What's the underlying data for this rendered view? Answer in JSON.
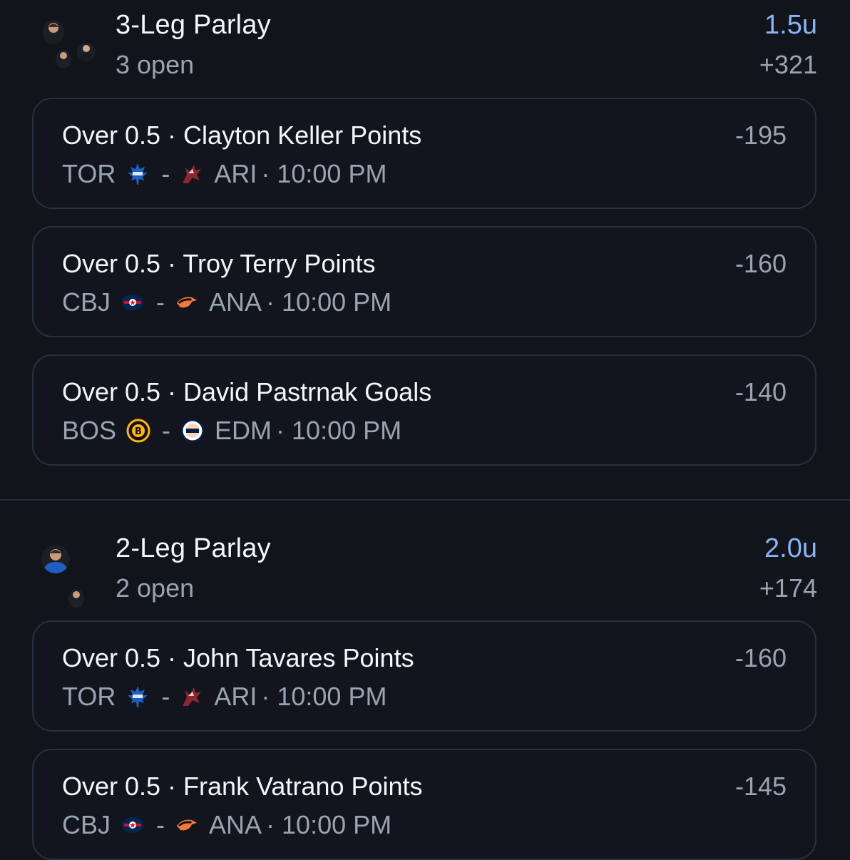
{
  "colors": {
    "background": "#11141b",
    "units_accent": "#8ab4f8",
    "muted": "#9aa3b2",
    "card_border": "#273041"
  },
  "parlays": [
    {
      "title": "3-Leg Parlay",
      "subtitle": "3 open",
      "units": "1.5u",
      "odds": "+321",
      "legs": [
        {
          "title": "Over 0.5 · Clayton Keller Points",
          "odds": "-195",
          "home": "TOR",
          "home_logo": "maple-leafs-icon",
          "dash": "-",
          "away": "ARI",
          "away_logo": "coyotes-icon",
          "time": "· 10:00 PM"
        },
        {
          "title": "Over 0.5 · Troy Terry Points",
          "odds": "-160",
          "home": "CBJ",
          "home_logo": "blue-jackets-icon",
          "dash": "-",
          "away": "ANA",
          "away_logo": "ducks-icon",
          "time": "· 10:00 PM"
        },
        {
          "title": "Over 0.5 · David Pastrnak Goals",
          "odds": "-140",
          "home": "BOS",
          "home_logo": "bruins-icon",
          "dash": "-",
          "away": "EDM",
          "away_logo": "oilers-icon",
          "time": "· 10:00 PM"
        }
      ]
    },
    {
      "title": "2-Leg Parlay",
      "subtitle": "2 open",
      "units": "2.0u",
      "odds": "+174",
      "legs": [
        {
          "title": "Over 0.5 · John Tavares Points",
          "odds": "-160",
          "home": "TOR",
          "home_logo": "maple-leafs-icon",
          "dash": "-",
          "away": "ARI",
          "away_logo": "coyotes-icon",
          "time": "· 10:00 PM"
        },
        {
          "title": "Over 0.5 · Frank Vatrano Points",
          "odds": "-145",
          "home": "CBJ",
          "home_logo": "blue-jackets-icon",
          "dash": "-",
          "away": "ANA",
          "away_logo": "ducks-icon",
          "time": "· 10:00 PM"
        }
      ]
    }
  ]
}
